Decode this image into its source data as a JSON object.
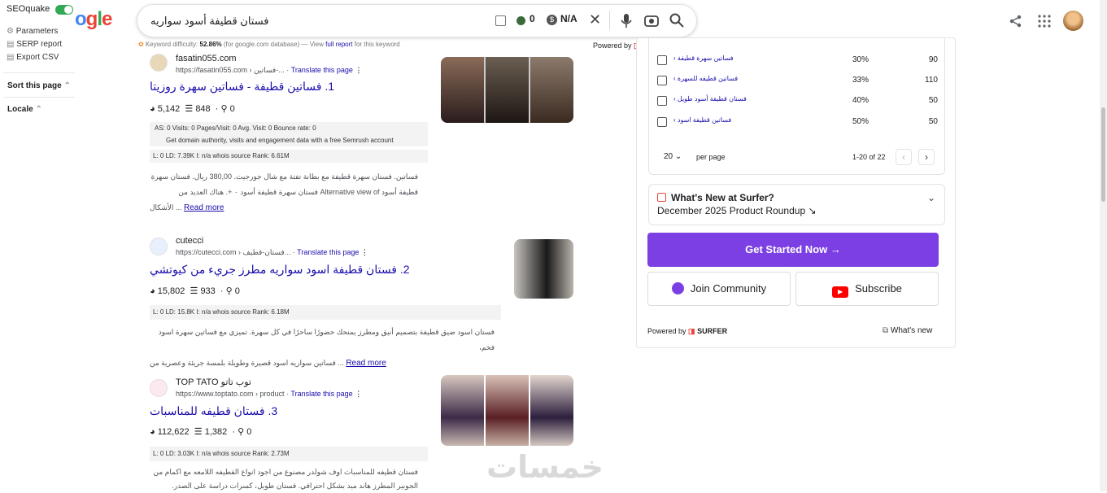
{
  "seoquake": {
    "title": "SEOquake",
    "items": [
      "Parameters",
      "SERP report",
      "Export CSV"
    ],
    "sort_label": "Sort this page",
    "locale_label": "Locale"
  },
  "logo_tail": "ogle",
  "search": {
    "query": "فستان قطيفة أسود سواريه",
    "count": "0",
    "na": "N/A"
  },
  "kd_line": {
    "label": "Keyword difficulty:",
    "value": "52.86%",
    "rest": "(for google.com database) — View",
    "link": "full report",
    "tail": "for this keyword"
  },
  "powered_top": "Powered by",
  "surfer": "SURFER",
  "results": [
    {
      "site": "fasatin055.com",
      "url": "https://fasatin055.com › فساتين-...",
      "translate": "Translate this page",
      "title": "1. فساتين قطيفة - فساتين سهرة روزيتا",
      "m1": "5,142",
      "m2": "848",
      "m3": "0",
      "seo1": "AS: 0      Visits: 0   Pages/Visit: 0   Avg. Visit: 0   Bounce rate: 0",
      "seo2": "Get domain authority, visits and engagement data with a free Semrush account",
      "seo3": "L: 0    LD: 7.39K    I: n/a    whois    source    Rank: 6.61M",
      "snippet1": "فساتين. فستان سهرة قطيفة مع بطانة تفتة مع شال جورجيت. 380,00 ريال. فستان سهرة",
      "snippet2": "قطيفة أسود Alternative view of فستان سهرة قطيفة أسود ٠ +. هناك العديد من",
      "snippet3": "الأشكال ...",
      "read_more": "Read more"
    },
    {
      "site": "cutecci",
      "url": "https://cutecci.com › فستان-قطيف...",
      "translate": "Translate this page",
      "title": "2. فستان قطيفة اسود سواريه مطرز جريء من كيوتشي",
      "m1": "15,802",
      "m2": "933",
      "m3": "0",
      "seo3": "L: 0    LD: 15.8K    I: n/a    whois    source    Rank: 6.18M",
      "snippet1": "فستان اسود ضيق قطيفة بتصميم أنيق ومطرز يمنحك حضورًا ساحرًا في كل سهرة. تميزي مع فساتين سهرة اسود فخم،",
      "snippet2": "فساتين سواريه اسود قصيرة وطويلة بلمسة جريئة وعصرية من ...",
      "read_more": "Read more"
    },
    {
      "site": "TOP TATO توب تاتو",
      "url": "https://www.toptato.com › product",
      "translate": "Translate this page",
      "title": "3. فستان قطيفه للمناسبات",
      "m1": "112,622",
      "m2": "1,382",
      "m3": "0",
      "seo3": "L: 0    LD: 3.03K    I: n/a    whois    source    Rank: 2.73M",
      "snippet1": "فستان قطيفه للمناسبات اوف شولدر مصنوع من اجود انواع القطيفه اللامعه مع اكمام من",
      "snippet2": "الجوبير المطرز هاند ميد بشكل احترافي. فستان طويل، كسرات دراسة على الصدر."
    }
  ],
  "keywords": [
    {
      "kw": "فساتين سهرة قطيفة",
      "pct": "30%",
      "vol": "90"
    },
    {
      "kw": "فساتين قطيفه للسهرة",
      "pct": "33%",
      "vol": "110"
    },
    {
      "kw": "فستان قطيفة أسود طويل",
      "pct": "40%",
      "vol": "50"
    },
    {
      "kw": "فساتين قطيفة اسود",
      "pct": "50%",
      "vol": "50"
    }
  ],
  "pager": {
    "per": "20",
    "per_label": "per page",
    "range": "1-20 of 22"
  },
  "whats_new": {
    "title": "What's New at Surfer?",
    "sub": "December 2025 Product Roundup ↘"
  },
  "buttons": {
    "start": "Get Started Now →",
    "community": "Join Community",
    "subscribe": "Subscribe"
  },
  "footer": {
    "powered": "Powered by",
    "whatsnew": "What's new"
  },
  "watermark": "خمسات"
}
